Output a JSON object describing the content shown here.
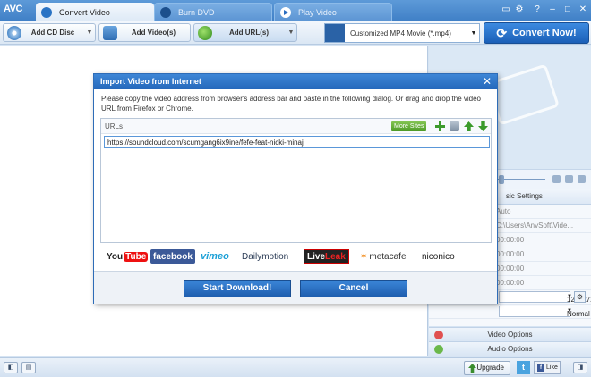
{
  "app": {
    "logo": "AVC"
  },
  "tabs": [
    {
      "label": "Convert Video"
    },
    {
      "label": "Burn DVD"
    },
    {
      "label": "Play Video"
    }
  ],
  "window_controls": {
    "gear": "⚙",
    "minimize": "▭",
    "help": "?",
    "min": "–",
    "max": "□",
    "close": "✕"
  },
  "toolbar": {
    "add_cd": "Add CD Disc",
    "add_video": "Add Video(s)",
    "add_url": "Add URL(s)",
    "profile": "Customized MP4 Movie (*.mp4)",
    "convert": "Convert Now!"
  },
  "settings": {
    "header": "sic Settings",
    "rows": [
      {
        "value": "Auto"
      },
      {
        "value": "C:\\Users\\AnvSoft\\Vide..."
      },
      {
        "value": "00:00:00"
      },
      {
        "value": "00:00:00"
      },
      {
        "value": "00:00:00"
      },
      {
        "value": "00:00:00"
      }
    ],
    "resolution": "1280x720",
    "quality": "Normal",
    "video_options": "Video Options",
    "audio_options": "Audio Options"
  },
  "statusbar": {
    "upgrade": "Upgrade",
    "twitter": "t",
    "like": "Like",
    "fb": "f"
  },
  "dialog": {
    "title": "Import Video from Internet",
    "close": "✕",
    "message": "Please copy the video address from browser's address bar and paste in the following dialog. Or drag and drop the video URL from Firefox or Chrome.",
    "urls_label": "URLs",
    "more_sites": "More Sites",
    "url_value": "https://soundcloud.com/scumgang6ix9ine/fefe-feat-nicki-minaj",
    "brands": {
      "youtube_a": "You",
      "youtube_b": "Tube",
      "facebook": "facebook",
      "vimeo": "vimeo",
      "dailymotion": "Dailymotion",
      "liveleak_a": "Live",
      "liveleak_b": "Leak",
      "metacafe": "metacafe",
      "niconico": "niconico"
    },
    "start": "Start Download!",
    "cancel": "Cancel"
  }
}
